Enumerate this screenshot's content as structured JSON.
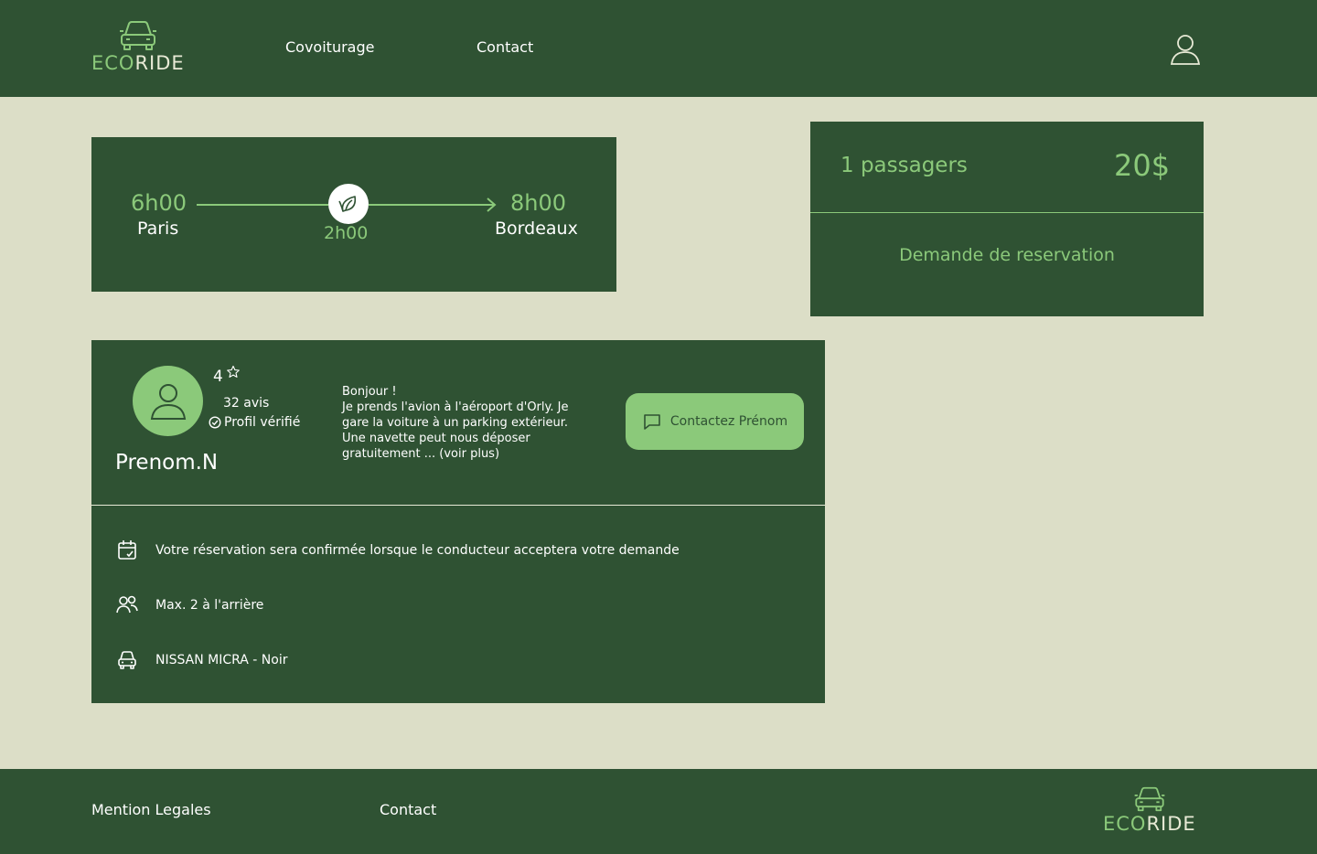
{
  "header": {
    "logo": {
      "eco": "ECO",
      "ride": "RIDE"
    },
    "nav": [
      {
        "label": "Covoiturage"
      },
      {
        "label": "Contact"
      }
    ],
    "user_icon": "user-icon"
  },
  "trip": {
    "departure_time": "6h00",
    "departure_city": "Paris",
    "arrival_time": "8h00",
    "arrival_city": "Bordeaux",
    "duration": "2h00",
    "badge_icon": "leaf-icon"
  },
  "booking": {
    "passengers": "1 passagers",
    "price": "20$",
    "reserve_label": "Demande de reservation"
  },
  "driver": {
    "rating": "4",
    "reviews": "32 avis",
    "verified": "Profil vérifié",
    "name": "Prenom.N",
    "message_lines": [
      "Bonjour !",
      "Je prends l'avion à l'aéroport d'Orly. Je",
      "gare la voiture à un parking extérieur.",
      "Une navette peut nous déposer",
      "gratuitement ... (voir plus)"
    ],
    "contact_label": "Contactez Prénom",
    "info": [
      {
        "icon": "calendar-check-icon",
        "text": "Votre réservation sera confirmée lorsque le conducteur acceptera votre demande"
      },
      {
        "icon": "users-icon",
        "text": "Max. 2 à l'arrière"
      },
      {
        "icon": "car-icon",
        "text": "NISSAN MICRA - Noir"
      }
    ]
  },
  "footer": {
    "links": [
      {
        "label": "Mention Legales"
      },
      {
        "label": "Contact"
      }
    ],
    "logo": {
      "eco": "ECO",
      "ride": "RIDE"
    }
  },
  "colors": {
    "primary": "#2f5233",
    "accent": "#8bc97a",
    "background": "#dcdec7",
    "text_light": "#ffffff"
  }
}
